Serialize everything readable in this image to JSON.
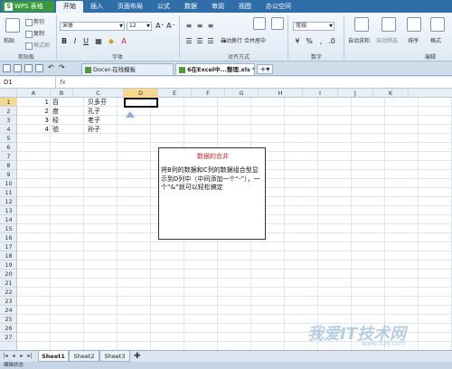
{
  "app": {
    "name": "WPS 表格",
    "logo": "S"
  },
  "ribbon_tabs": [
    "开始",
    "插入",
    "页面布局",
    "公式",
    "数据",
    "审阅",
    "视图",
    "办公空间"
  ],
  "ribbon": {
    "clipboard": {
      "cut": "剪切",
      "copy": "复制",
      "paste": "粘贴",
      "format_painter": "格式刷",
      "label": "剪贴板"
    },
    "font": {
      "name": "宋体",
      "size": "12",
      "label": "字体",
      "bold": "B",
      "italic": "I",
      "underline": "U",
      "grow": "A⁺",
      "shrink": "A⁻"
    },
    "alignment": {
      "merge": "合并居中",
      "wrap": "自动换行",
      "label": "对齐方式"
    },
    "number": {
      "format": "常规",
      "label": "数字"
    },
    "right": {
      "autosum": "自动求和",
      "sort": "排序",
      "format": "格式",
      "filter": "自动筛选",
      "label": "编辑"
    }
  },
  "doc_tabs": [
    {
      "label": "Docer-在线模板",
      "active": false
    },
    {
      "label": "6在Excel中...整理.xls *",
      "active": true
    }
  ],
  "formula_bar": {
    "cell_ref": "D1",
    "fx": "fx"
  },
  "columns": [
    "A",
    "B",
    "C",
    "D",
    "E",
    "F",
    "G",
    "H",
    "I",
    "J",
    "K"
  ],
  "selected_column": "D",
  "rows": [
    "1",
    "2",
    "3",
    "4",
    "5",
    "6",
    "7",
    "8",
    "9",
    "10",
    "11",
    "12",
    "13",
    "14",
    "15",
    "16",
    "17",
    "18",
    "19",
    "20",
    "21",
    "22",
    "23",
    "24",
    "25",
    "26",
    "27"
  ],
  "selected_row": "1",
  "cells": {
    "A": [
      "1",
      "2",
      "3",
      "4"
    ],
    "B": [
      "百",
      "度",
      "经",
      "验"
    ],
    "C": [
      "贝多芬",
      "孔子",
      "老子",
      "孙子"
    ]
  },
  "textbox": {
    "title": "数据的合并",
    "body": "将B列的数据和C列的数据组合型显示到D列中（中间添加一个“-”），一个“&”就可以轻松搞定"
  },
  "sheets": [
    {
      "label": "Sheet1",
      "active": true
    },
    {
      "label": "Sheet2",
      "active": false
    },
    {
      "label": "Sheet3",
      "active": false
    }
  ],
  "status": "编辑状态",
  "watermark": {
    "main": "我爱IT技术网",
    "sub": "www.52ij.com"
  }
}
